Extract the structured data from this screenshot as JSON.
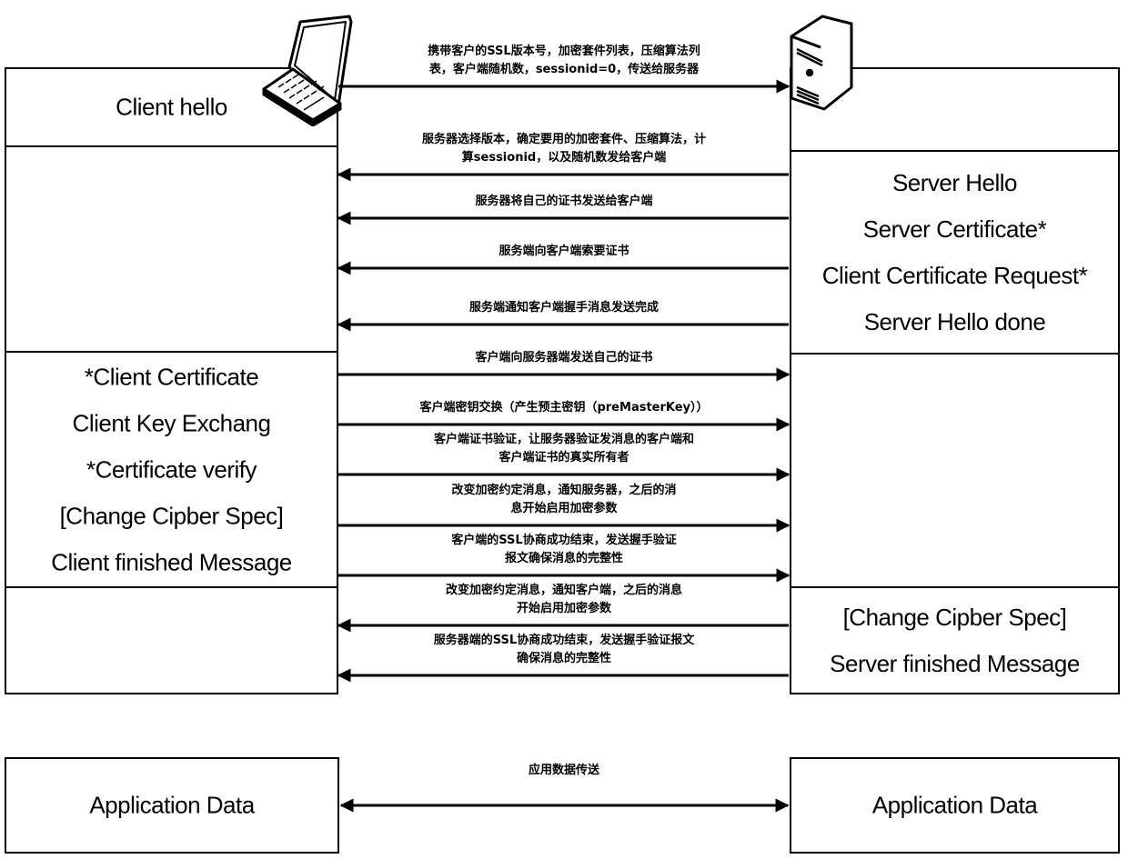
{
  "client": {
    "hello_box": {
      "lines": [
        "Client hello"
      ]
    },
    "key_exchange_box": {
      "lines": [
        "*Client Certificate",
        "Client Key Exchang",
        "*Certificate verify",
        "[Change Cipber Spec]",
        "Client finished Message"
      ]
    },
    "app_box": {
      "lines": [
        "Application Data"
      ]
    }
  },
  "server": {
    "hello_box": {
      "lines": [
        "Server Hello",
        "Server Certificate*",
        "Client Certificate Request*",
        "Server Hello done"
      ]
    },
    "finished_box": {
      "lines": [
        "[Change Cipber Spec]",
        "Server finished Message"
      ]
    },
    "app_box": {
      "lines": [
        "Application Data"
      ]
    }
  },
  "icons": {
    "client": "laptop-icon",
    "server": "server-tower-icon"
  },
  "messages": [
    {
      "direction": "to-server",
      "lines": [
        "携带客户的SSL版本号，加密套件列表，压缩算法列",
        "表，客户端随机数，sessionid=0，传送给服务器"
      ]
    },
    {
      "direction": "to-client",
      "lines": [
        "服务器选择版本，确定要用的加密套件、压缩算法，计",
        "算sessionid，以及随机数发给客户端"
      ]
    },
    {
      "direction": "to-client",
      "lines": [
        "服务器将自己的证书发送给客户端"
      ]
    },
    {
      "direction": "to-client",
      "lines": [
        "服务端向客户端索要证书"
      ]
    },
    {
      "direction": "to-client",
      "lines": [
        "服务端通知客户端握手消息发送完成"
      ]
    },
    {
      "direction": "to-server",
      "lines": [
        "客户端向服务器端发送自己的证书"
      ]
    },
    {
      "direction": "to-server",
      "lines": [
        "客户端密钥交换（产生预主密钥（preMasterKey））"
      ]
    },
    {
      "direction": "to-server",
      "lines": [
        "客户端证书验证，让服务器验证发消息的客户端和",
        "客户端证书的真实所有者"
      ]
    },
    {
      "direction": "to-server",
      "lines": [
        "改变加密约定消息，通知服务器，之后的消",
        "息开始启用加密参数"
      ]
    },
    {
      "direction": "to-server",
      "lines": [
        "客户端的SSL协商成功结束，发送握手验证",
        "报文确保消息的完整性"
      ]
    },
    {
      "direction": "to-client",
      "lines": [
        "改变加密约定消息，通知客户端，之后的消息",
        "开始启用加密参数"
      ]
    },
    {
      "direction": "to-client",
      "lines": [
        "服务器端的SSL协商成功结束，发送握手验证报文",
        "确保消息的完整性"
      ]
    }
  ],
  "app_data_transfer": {
    "direction": "bidirectional",
    "label": "应用数据传送"
  }
}
